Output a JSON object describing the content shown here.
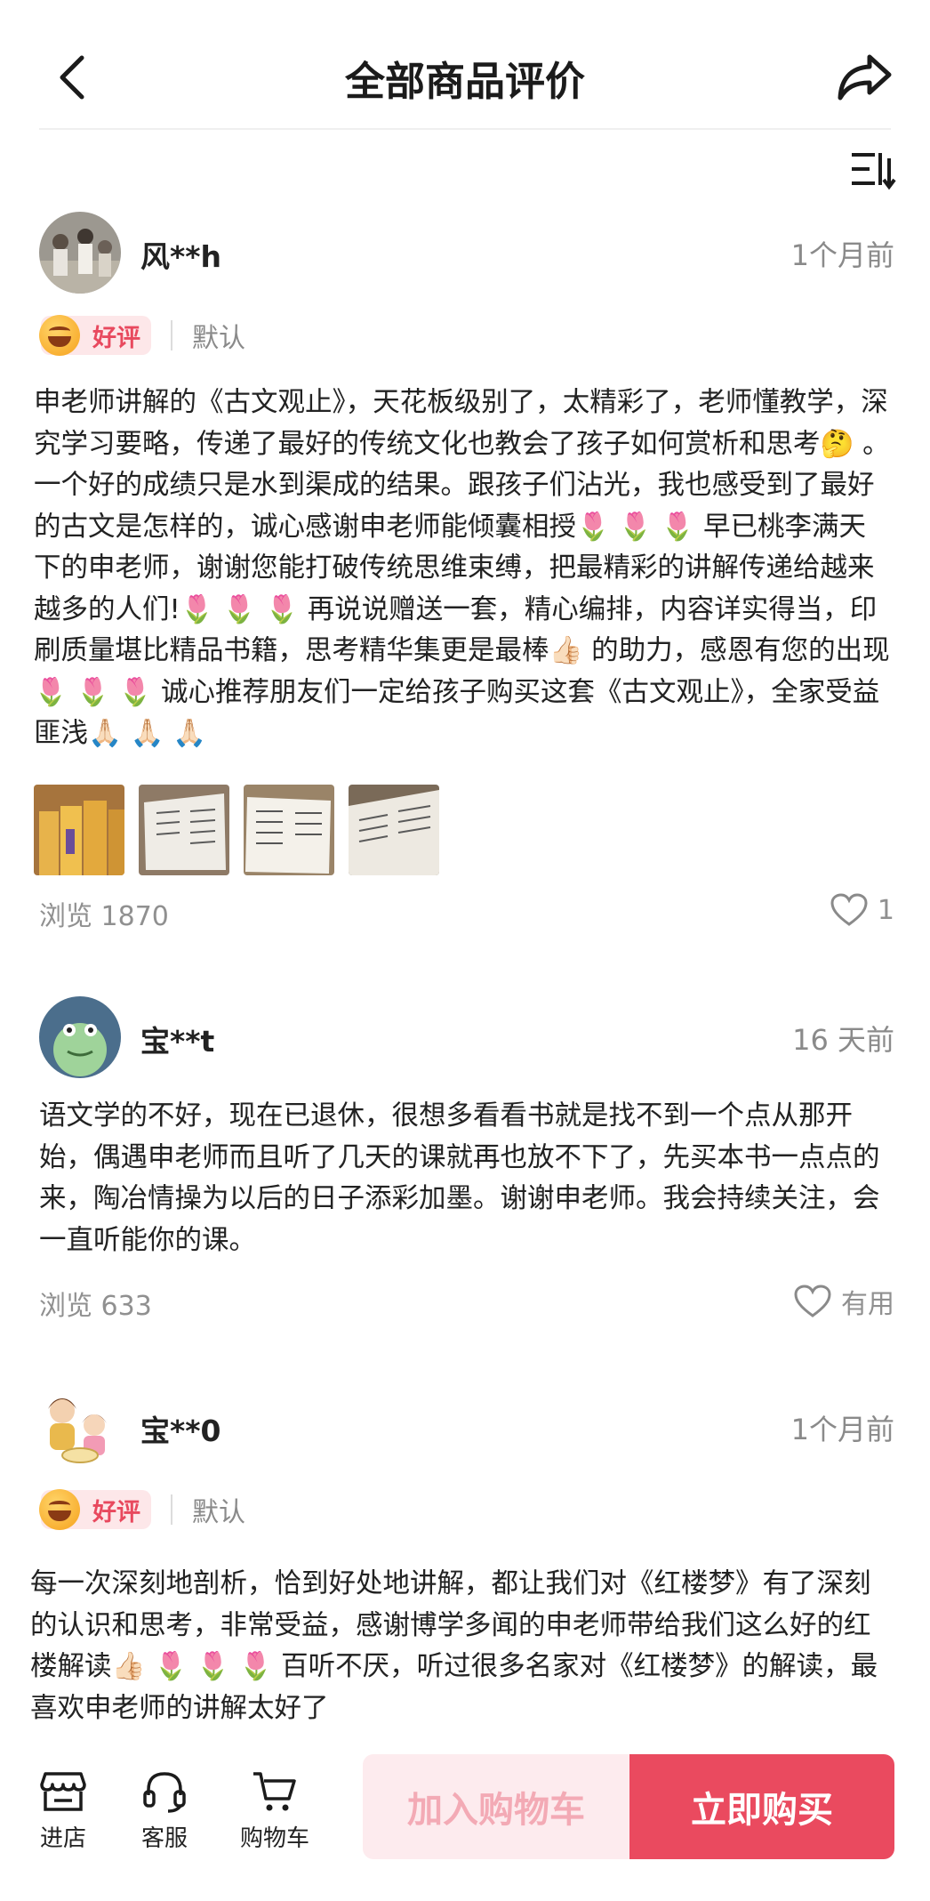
{
  "header": {
    "title": "全部商品评价"
  },
  "reviews": [
    {
      "username": "风**h",
      "time": "1个月前",
      "rating": "好评",
      "rating_default": "默认",
      "content": "申老师讲解的《古文观止》，天花板级别了，太精彩了，老师懂教学，深究学习要略，传递了最好的传统文化也教会了孩子如何赏析和思考🤔 。一个好的成绩只是水到渠成的结果。跟孩子们沾光，我也感受到了最好的古文是怎样的，诚心感谢申老师能倾囊相授🌷 🌷 🌷 早已桃李满天下的申老师，谢谢您能打破传统思维束缚，把最精彩的讲解传递给越来越多的人们!🌷 🌷 🌷 再说说赠送一套，精心编排，内容详实得当，印刷质量堪比精品书籍，思考精华集更是最棒👍🏻 的助力，感恩有您的出现🌷 🌷 🌷 诚心推荐朋友们一定给孩子购买这套《古文观止》，全家受益匪浅🙏🏻 🙏🏻 🙏🏻",
      "views": "浏览 1870",
      "likes": "1"
    },
    {
      "username": "宝**t",
      "time": "16 天前",
      "content": "语文学的不好，现在已退休，很想多看看书就是找不到一个点从那开始，偶遇申老师而且听了几天的课就再也放不下了，先买本书一点点的来，陶冶情操为以后的日子添彩加墨。谢谢申老师。我会持续关注，会一直听能你的课。",
      "views": "浏览 633",
      "likes": "有用"
    },
    {
      "username": "宝**0",
      "time": "1个月前",
      "rating": "好评",
      "rating_default": "默认",
      "content": "每一次深刻地剖析，恰到好处地讲解，都让我们对《红楼梦》有了深刻的认识和思考，非常受益，感谢博学多闻的申老师带给我们这么好的红楼解读👍🏻 🌷 🌷 🌷 百听不厌，听过很多名家对《红楼梦》的解读，最喜欢申老师的讲解太好了"
    }
  ],
  "bottom_bar": {
    "store_label": "进店",
    "service_label": "客服",
    "cart_label": "购物车",
    "add_to_cart": "加入购物车",
    "buy_now": "立即购买"
  },
  "colors": {
    "accent": "#ea4a5f",
    "accent_light": "#fdebee",
    "muted": "#8a8a8a"
  }
}
